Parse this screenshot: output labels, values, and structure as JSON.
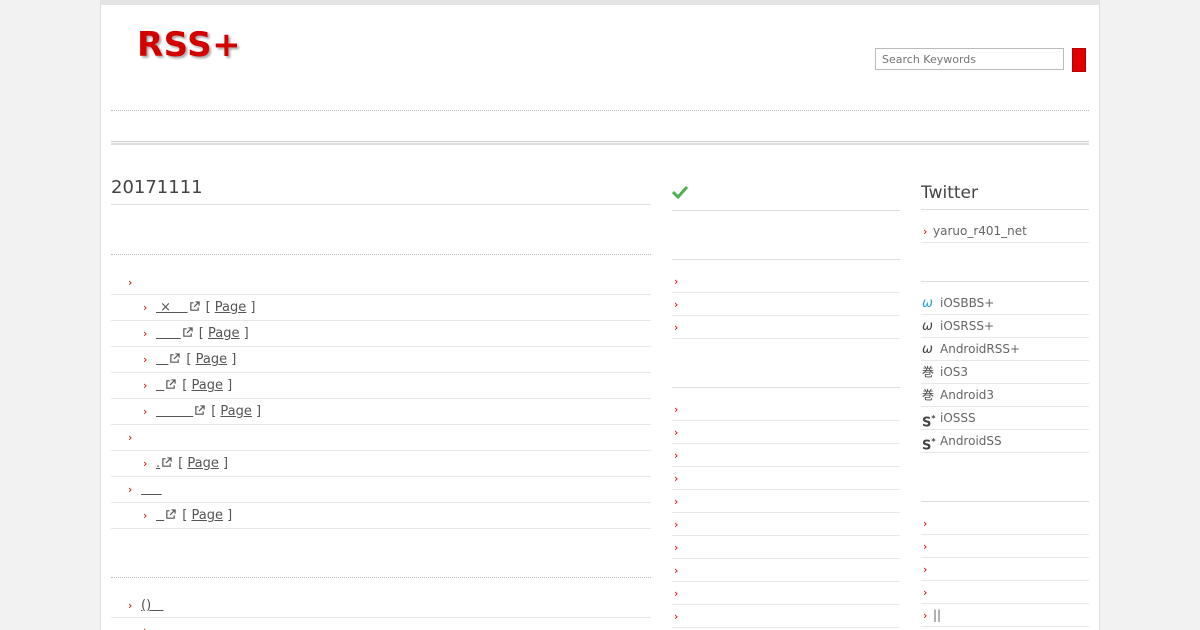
{
  "header": {
    "logo": "RSS+",
    "search_placeholder": "Search Keywords"
  },
  "main": {
    "date_title": "20171111",
    "groups": [
      {
        "label": "",
        "items": [
          {
            "title": " ×    ",
            "page_label": "Page"
          },
          {
            "title": "      ",
            "page_label": "Page"
          },
          {
            "title": "   ",
            "page_label": "Page"
          },
          {
            "title": "  ",
            "page_label": "Page"
          },
          {
            "title": "         ",
            "page_label": "Page"
          }
        ]
      },
      {
        "label": "",
        "items": [
          {
            "title": ".",
            "page_label": "Page"
          }
        ]
      },
      {
        "label": "     ",
        "items": [
          {
            "title": "  ",
            "page_label": "Page"
          }
        ]
      }
    ],
    "second_group_label": "()   "
  },
  "middle": {
    "icon": "check-icon",
    "list_a_count": 3,
    "list_b_count": 10
  },
  "right": {
    "twitter_title": "Twitter",
    "twitter_account": "yaruo_r401_net",
    "apps": [
      {
        "icon": "omega-icon",
        "glyph": "ω",
        "label": "iOSBBS+",
        "color": "#2a9fd6"
      },
      {
        "icon": "omega-icon",
        "glyph": "ω",
        "label": "iOSRSS+",
        "color": "#444444"
      },
      {
        "icon": "omega-icon",
        "glyph": "ω",
        "label": "AndroidRSS+",
        "color": "#444444"
      },
      {
        "icon": "kan-icon",
        "glyph": "巻",
        "label": "iOS3",
        "color": "#444444"
      },
      {
        "icon": "kan-icon",
        "glyph": "巻",
        "label": "Android3",
        "color": "#444444"
      },
      {
        "icon": "ss-icon",
        "glyph": "S*",
        "label": "iOSSS",
        "color": "#444444"
      },
      {
        "icon": "ss-icon",
        "glyph": "S*",
        "label": "AndroidSS",
        "color": "#444444"
      }
    ],
    "bottom_list": [
      "",
      "",
      "",
      "",
      "||"
    ]
  },
  "colors": {
    "accent": "#d40000",
    "chevron": "#cc0000"
  }
}
